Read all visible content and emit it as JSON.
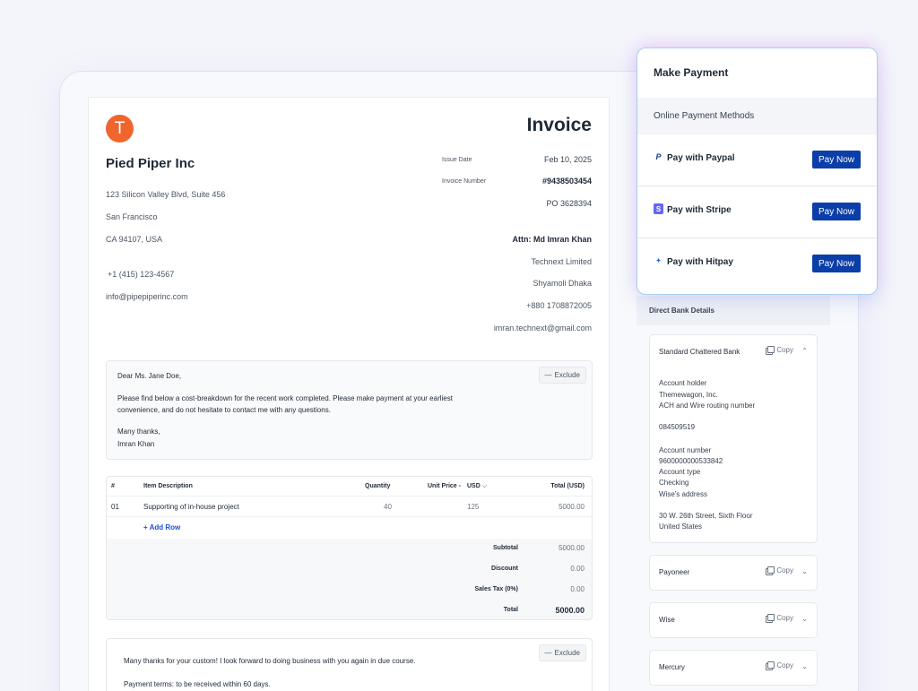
{
  "invoice": {
    "logo_letter": "T",
    "title": "Invoice",
    "company_name": "Pied Piper Inc",
    "from_lines": [
      "123 Silicon Valley Blvd, Suite 456",
      "San Francisco",
      "CA 94107, USA"
    ],
    "phone": "+1 (415) 123-4567",
    "email": "info@pipepiperinc.com",
    "issue_date_label": "Issue Date",
    "issue_date": "Feb 10, 2025",
    "invoice_number_label": "Invoice Number",
    "invoice_number": "#9438503454",
    "po": "PO 3628394",
    "attn": "Attn: Md Imran Khan",
    "to_lines": [
      "Technext Limited",
      "Shyamoli Dhaka",
      "+880 1708872005",
      "imran.technext@gmail.com"
    ]
  },
  "note": {
    "exclude_label": "Exclude",
    "greeting": "Dear  Ms. Jane Doe,",
    "body_line1": "Please find below a cost-breakdown for the recent work completed. Please make payment at your earliest",
    "body_line2": "convenience, and do not hesitate to contact me with any questions.",
    "thanks": "Many thanks,",
    "signature": "Imran Khan"
  },
  "items": {
    "headers": {
      "num": "#",
      "description": "Item Description",
      "quantity": "Quantity",
      "unit_price": "Unit Price -",
      "currency": "USD",
      "total": "Total (USD)"
    },
    "rows": [
      {
        "num": "01",
        "description": "Supporting of in-house project",
        "quantity": "40",
        "unit_price": "125",
        "total": "5000.00"
      }
    ],
    "add_row_label": "Add Row",
    "subtotal_label": "Subtotal",
    "subtotal": "5000.00",
    "discount_label": "Discount",
    "discount": "0.00",
    "tax_label": "Sales Tax (0%)",
    "tax": "0.00",
    "total_label": "Total",
    "total": "5000.00"
  },
  "footer_note": {
    "exclude_label": "Exclude",
    "line1": "Many thanks for your custom! I look forward to doing business with you again in due course.",
    "line2": "Payment terms: to be received within 60 days."
  },
  "payment": {
    "title": "Make Payment",
    "online_label": "Online Payment Methods",
    "methods": [
      {
        "label": "Pay with Paypal",
        "button": "Pay Now"
      },
      {
        "label": "Pay with Stripe",
        "button": "Pay Now"
      },
      {
        "label": "Pay with Hitpay",
        "button": "Pay Now"
      }
    ]
  },
  "bank": {
    "section_label": "Direct Bank Details",
    "copy_label": "Copy",
    "expanded": {
      "name": "Standard Chattered Bank",
      "lines": [
        "Account holder",
        "Themewagon, Inc.",
        "ACH and Wire routing number",
        "084509519",
        "Account number",
        "9600000000533842",
        "Account type",
        "Checking",
        "Wise's address",
        "30 W. 26th Street, Sixth Floor",
        "United States"
      ]
    },
    "others": [
      "Payoneer",
      "Wise",
      "Mercury"
    ]
  }
}
